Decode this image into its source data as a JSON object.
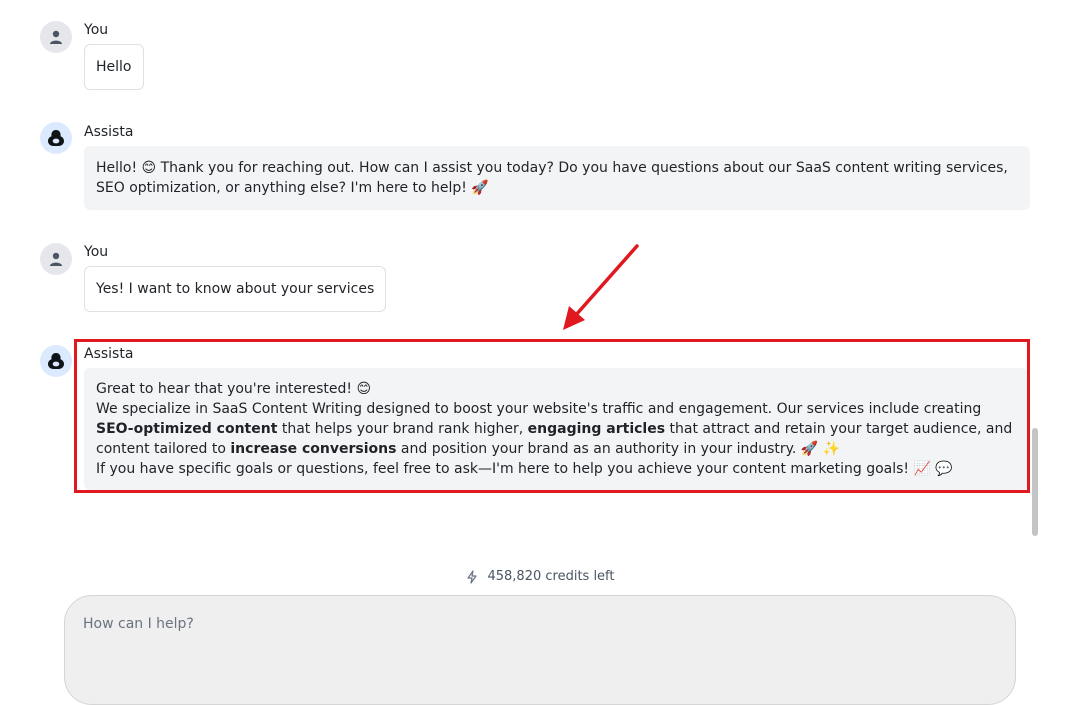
{
  "messages": [
    {
      "sender": "You",
      "type": "user",
      "text": "Hello"
    },
    {
      "sender": "Assista",
      "type": "bot",
      "text": "Hello! 😊 Thank you for reaching out. How can I assist you today? Do you have questions about our SaaS content writing services, SEO optimization, or anything else? I'm here to help! 🚀"
    },
    {
      "sender": "You",
      "type": "user",
      "text": "Yes! I want to know about your services"
    },
    {
      "sender": "Assista",
      "type": "bot",
      "line1": "Great to hear that you're interested! 😊",
      "line2_a": "We specialize in SaaS Content Writing designed to boost your website's traffic and engagement. Our services include creating ",
      "line2_b1": "SEO-optimized content",
      "line2_c": " that helps your brand rank higher, ",
      "line2_b2": "engaging articles",
      "line2_d": " that attract and retain your target audience, and content tailored to ",
      "line2_b3": "increase conversions",
      "line2_e": " and position your brand as an authority in your industry. 🚀 ✨",
      "line3": "If you have specific goals or questions, feel free to ask—I'm here to help you achieve your content marketing goals! 📈 💬"
    }
  ],
  "credits": {
    "icon": "lightning-icon",
    "text": "458,820 credits left"
  },
  "composer": {
    "placeholder": "How can I help?"
  },
  "colors": {
    "highlight": "#e0181f",
    "bot_bubble": "#f3f4f6",
    "user_avatar": "#e5e7eb"
  }
}
